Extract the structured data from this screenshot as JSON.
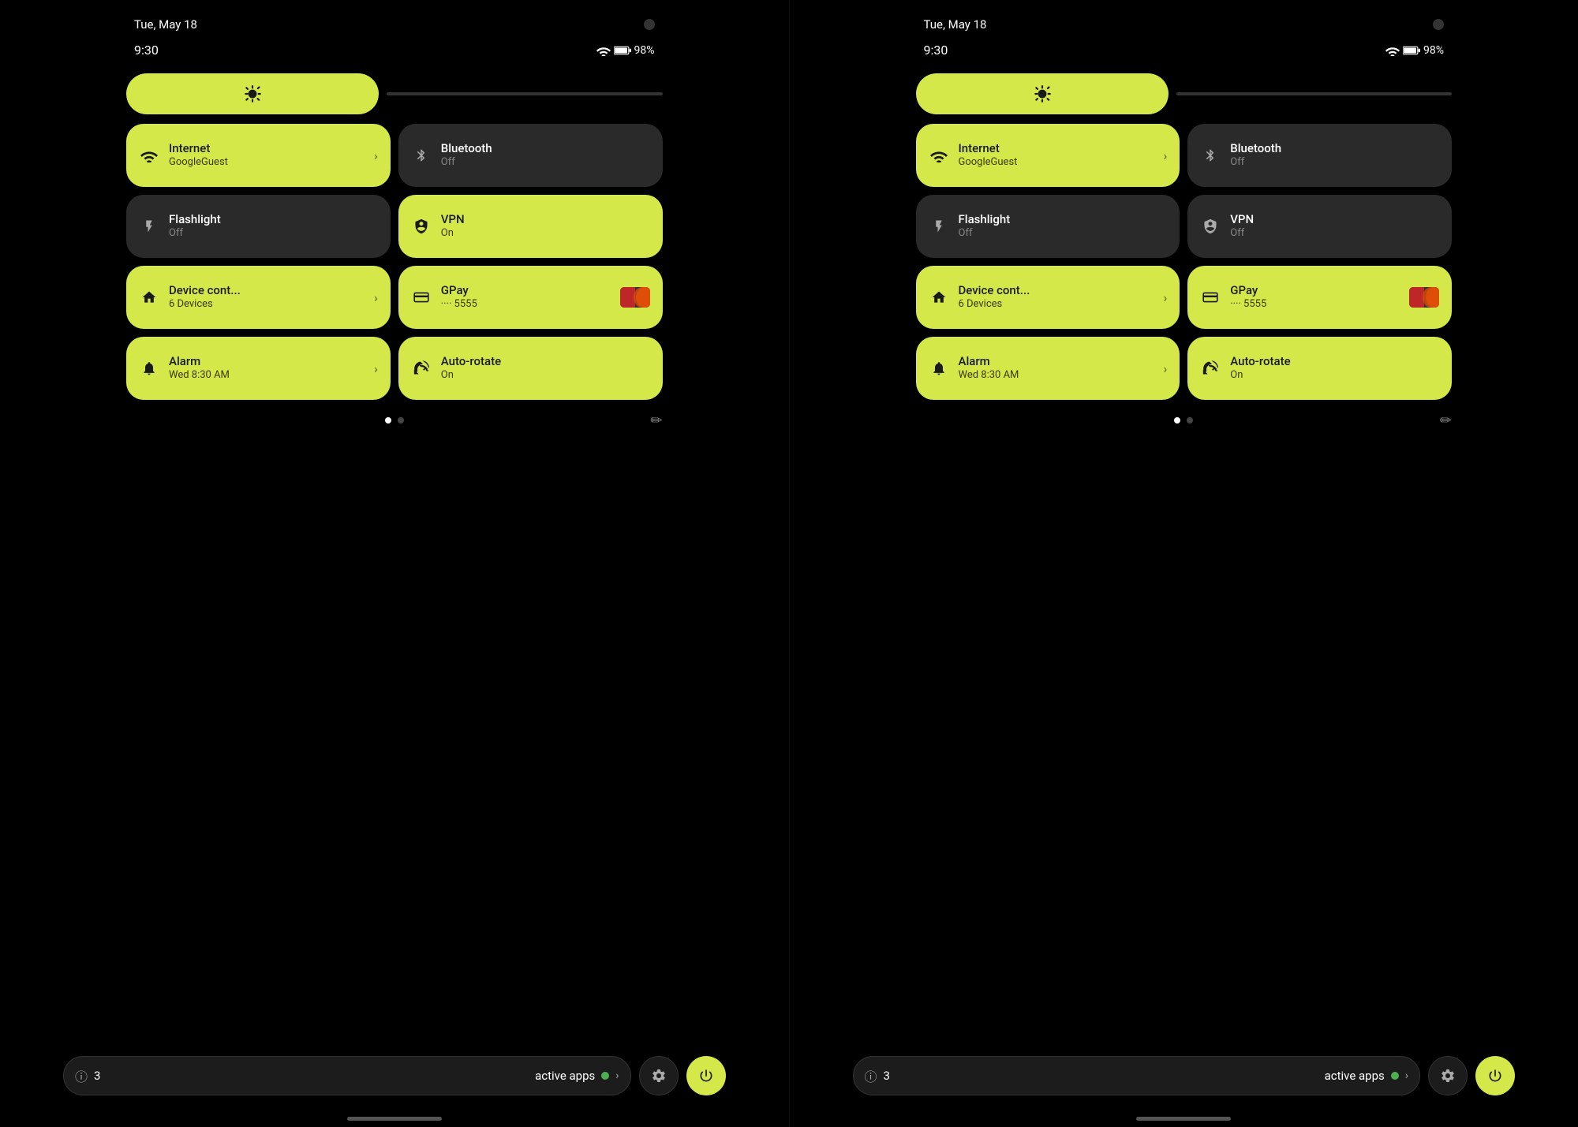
{
  "panels": [
    {
      "id": "left",
      "status": {
        "date": "Tue, May 18",
        "time": "9:30",
        "battery": "98%"
      },
      "brightness": {
        "icon": "⚙"
      },
      "tiles": [
        {
          "id": "internet",
          "title": "Internet",
          "subtitle": "GoogleGuest",
          "active": true,
          "icon": "wifi",
          "hasChevron": true
        },
        {
          "id": "bluetooth",
          "title": "Bluetooth",
          "subtitle": "Off",
          "active": false,
          "icon": "bluetooth",
          "hasChevron": false
        },
        {
          "id": "flashlight",
          "title": "Flashlight",
          "subtitle": "Off",
          "active": false,
          "icon": "flashlight",
          "hasChevron": false
        },
        {
          "id": "vpn",
          "title": "VPN",
          "subtitle": "On",
          "active": true,
          "icon": "vpn",
          "hasChevron": false
        },
        {
          "id": "device-control",
          "title": "Device cont...",
          "subtitle": "6 Devices",
          "active": true,
          "icon": "home",
          "hasChevron": true
        },
        {
          "id": "gpay",
          "title": "GPay",
          "subtitle": "···· 5555",
          "active": true,
          "icon": "card",
          "hasChevron": false,
          "hasCard": true
        },
        {
          "id": "alarm",
          "title": "Alarm",
          "subtitle": "Wed 8:30 AM",
          "active": true,
          "icon": "alarm",
          "hasChevron": true
        },
        {
          "id": "autorotate",
          "title": "Auto-rotate",
          "subtitle": "On",
          "active": true,
          "icon": "rotate",
          "hasChevron": false
        }
      ],
      "activeApps": {
        "count": "3",
        "label": "active apps"
      }
    },
    {
      "id": "right",
      "status": {
        "date": "Tue, May 18",
        "time": "9:30",
        "battery": "98%"
      },
      "brightness": {
        "icon": "⚙"
      },
      "tiles": [
        {
          "id": "internet",
          "title": "Internet",
          "subtitle": "GoogleGuest",
          "active": true,
          "icon": "wifi",
          "hasChevron": true
        },
        {
          "id": "bluetooth",
          "title": "Bluetooth",
          "subtitle": "Off",
          "active": false,
          "icon": "bluetooth",
          "hasChevron": false
        },
        {
          "id": "flashlight",
          "title": "Flashlight",
          "subtitle": "Off",
          "active": false,
          "icon": "flashlight",
          "hasChevron": false
        },
        {
          "id": "vpn",
          "title": "VPN",
          "subtitle": "Off",
          "active": false,
          "icon": "vpn",
          "hasChevron": false
        },
        {
          "id": "device-control",
          "title": "Device cont...",
          "subtitle": "6 Devices",
          "active": true,
          "icon": "home",
          "hasChevron": true
        },
        {
          "id": "gpay",
          "title": "GPay",
          "subtitle": "···· 5555",
          "active": true,
          "icon": "card",
          "hasChevron": false,
          "hasCard": true
        },
        {
          "id": "alarm",
          "title": "Alarm",
          "subtitle": "Wed 8:30 AM",
          "active": true,
          "icon": "alarm",
          "hasChevron": true
        },
        {
          "id": "autorotate",
          "title": "Auto-rotate",
          "subtitle": "On",
          "active": true,
          "icon": "rotate",
          "hasChevron": false
        }
      ],
      "activeApps": {
        "count": "3",
        "label": "active apps"
      }
    }
  ],
  "colors": {
    "active_tile": "#d4e84a",
    "inactive_tile": "#2a2a2a",
    "bg": "#000000"
  }
}
